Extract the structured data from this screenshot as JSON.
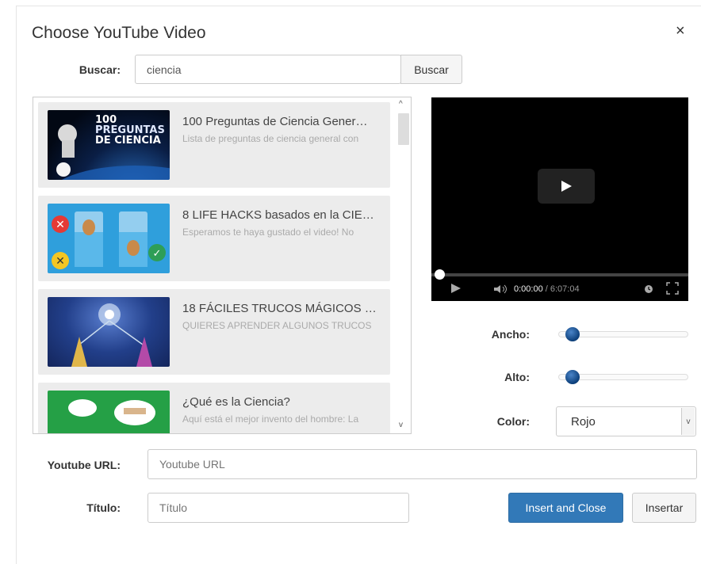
{
  "dialog": {
    "title": "Choose YouTube Video",
    "close_label": "×"
  },
  "search": {
    "label": "Buscar:",
    "value": "ciencia",
    "button_label": "Buscar"
  },
  "results": [
    {
      "title": "100 Preguntas de Ciencia Gener…",
      "description": "Lista de preguntas de ciencia general con",
      "thumb_text": [
        "100",
        "PREGUNTAS",
        "DE CIENCIA"
      ]
    },
    {
      "title": "8 LIFE HACKS basados en la CIE…",
      "description": "Esperamos te haya gustado el video! No"
    },
    {
      "title": "18 FÁCILES TRUCOS MÁGICOS …",
      "description": "QUIERES APRENDER ALGUNOS TRUCOS"
    },
    {
      "title": "¿Qué es la Ciencia?",
      "description": "Aquí está el mejor invento del hombre: La"
    }
  ],
  "player": {
    "current_time": "0:00:00",
    "duration": "/ 6:07:04",
    "progress": 0.0
  },
  "settings": {
    "width_label": "Ancho:",
    "height_label": "Alto:",
    "color_label": "Color:",
    "color_value": "Rojo",
    "width_level": 0.0,
    "height_level": 0.0
  },
  "url": {
    "label": "Youtube URL:",
    "placeholder": "Youtube URL",
    "value": ""
  },
  "titulo": {
    "label": "Título:",
    "placeholder": "Título",
    "value": ""
  },
  "buttons": {
    "insert_close": "Insert and Close",
    "insert": "Insertar"
  },
  "colors": {
    "primary": "#3279b8",
    "item_bg": "#ececec",
    "knob": "#0c3f7a"
  }
}
